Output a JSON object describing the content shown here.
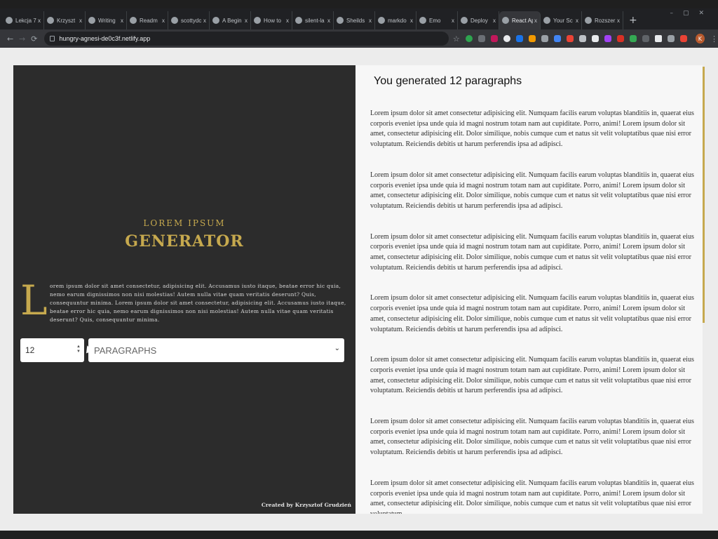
{
  "browser": {
    "tabs": [
      {
        "label": "Lekcja 7:"
      },
      {
        "label": "Krzyszt"
      },
      {
        "label": "Writing"
      },
      {
        "label": "Readm"
      },
      {
        "label": "scottydc"
      },
      {
        "label": "A Begin"
      },
      {
        "label": "How to"
      },
      {
        "label": "silent-la"
      },
      {
        "label": "Sheilds"
      },
      {
        "label": "markdo"
      },
      {
        "label": "Emo"
      },
      {
        "label": "Deploy"
      },
      {
        "label": "React Ap"
      },
      {
        "label": "Your Sc"
      },
      {
        "label": "Rozszerz"
      }
    ],
    "active_tab_index": 12,
    "close_glyph": "x",
    "new_tab_glyph": "+",
    "url": "hungry-agnesi-de0c3f.netlify.app",
    "profile_initial": "K"
  },
  "page": {
    "subtitle": "LOREM IPSUM",
    "title": "GENERATOR",
    "dropcap": "L",
    "intro": "orem ipsum dolor sit amet consectetur, adipisicing elit. Accusamus iusto itaque, beatae error hic quia, nemo earum dignissimos non nisi molestias! Autem nulla vitae quam veritatis deserunt? Quis, consequuntur minima. Lorem ipsum dolor sit amet consectetur, adipisicing elit. Accusamus iusto itaque, beatae error hic quia, nemo earum dignissimos non nisi molestias! Autem nulla vitae quam veritatis deserunt? Quis, consequuntur minima.",
    "count_value": "12",
    "unit_selected": "PARAGRAPHS",
    "credits": "Created by Krzysztof Grudzień",
    "heading": "You generated 12 paragraphs",
    "paragraphs": [
      "Lorem ipsum dolor sit amet consectetur adipisicing elit. Numquam facilis earum voluptas blanditiis in, quaerat eius corporis eveniet ipsa unde quia id magni nostrum totam nam aut cupiditate. Porro, animi! Lorem ipsum dolor sit amet, consectetur adipisicing elit. Dolor similique, nobis cumque cum et natus sit velit voluptatibus quae nisi error voluptatum. Reiciendis debitis ut harum perferendis ipsa ad adipisci.",
      "Lorem ipsum dolor sit amet consectetur adipisicing elit. Numquam facilis earum voluptas blanditiis in, quaerat eius corporis eveniet ipsa unde quia id magni nostrum totam nam aut cupiditate. Porro, animi! Lorem ipsum dolor sit amet, consectetur adipisicing elit. Dolor similique, nobis cumque cum et natus sit velit voluptatibus quae nisi error voluptatum. Reiciendis debitis ut harum perferendis ipsa ad adipisci.",
      "Lorem ipsum dolor sit amet consectetur adipisicing elit. Numquam facilis earum voluptas blanditiis in, quaerat eius corporis eveniet ipsa unde quia id magni nostrum totam nam aut cupiditate. Porro, animi! Lorem ipsum dolor sit amet, consectetur adipisicing elit. Dolor similique, nobis cumque cum et natus sit velit voluptatibus quae nisi error voluptatum. Reiciendis debitis ut harum perferendis ipsa ad adipisci.",
      "Lorem ipsum dolor sit amet consectetur adipisicing elit. Numquam facilis earum voluptas blanditiis in, quaerat eius corporis eveniet ipsa unde quia id magni nostrum totam nam aut cupiditate. Porro, animi! Lorem ipsum dolor sit amet, consectetur adipisicing elit. Dolor similique, nobis cumque cum et natus sit velit voluptatibus quae nisi error voluptatum. Reiciendis debitis ut harum perferendis ipsa ad adipisci.",
      "Lorem ipsum dolor sit amet consectetur adipisicing elit. Numquam facilis earum voluptas blanditiis in, quaerat eius corporis eveniet ipsa unde quia id magni nostrum totam nam aut cupiditate. Porro, animi! Lorem ipsum dolor sit amet, consectetur adipisicing elit. Dolor similique, nobis cumque cum et natus sit velit voluptatibus quae nisi error voluptatum. Reiciendis debitis ut harum perferendis ipsa ad adipisci.",
      "Lorem ipsum dolor sit amet consectetur adipisicing elit. Numquam facilis earum voluptas blanditiis in, quaerat eius corporis eveniet ipsa unde quia id magni nostrum totam nam aut cupiditate. Porro, animi! Lorem ipsum dolor sit amet, consectetur adipisicing elit. Dolor similique, nobis cumque cum et natus sit velit voluptatibus quae nisi error voluptatum. Reiciendis debitis ut harum perferendis ipsa ad adipisci.",
      "Lorem ipsum dolor sit amet consectetur adipisicing elit. Numquam facilis earum voluptas blanditiis in, quaerat eius corporis eveniet ipsa unde quia id magni nostrum totam nam aut cupiditate. Porro, animi! Lorem ipsum dolor sit amet, consectetur adipisicing elit. Dolor similique, nobis cumque cum et natus sit velit voluptatibus quae nisi error voluptatum."
    ]
  },
  "colors": {
    "accent_gold": "#c6a94e",
    "panel_dark": "#2c2c2c"
  }
}
